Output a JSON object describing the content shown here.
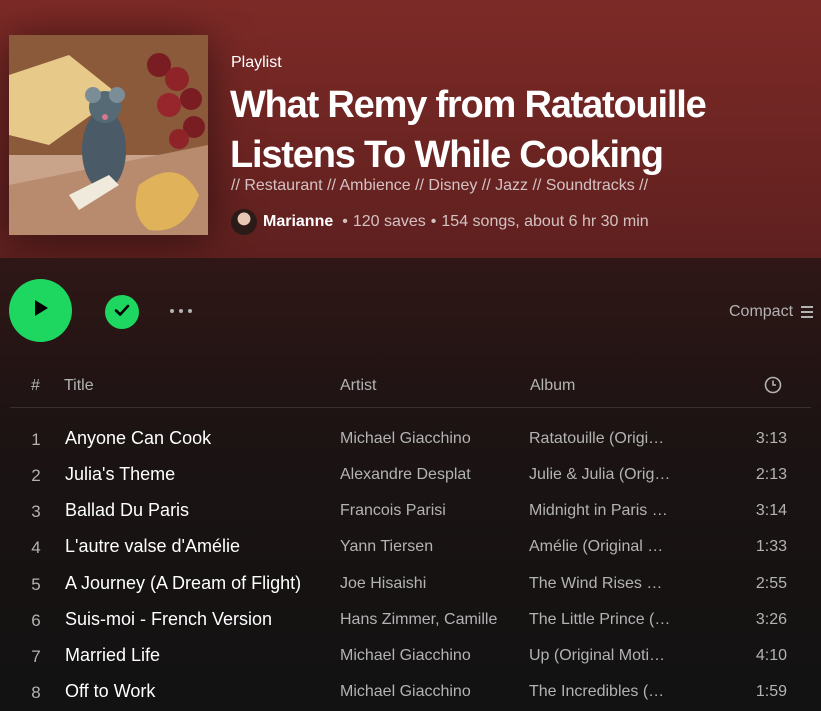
{
  "playlist": {
    "type_label": "Playlist",
    "title": "What Remy from Ratatouille Listens To While Cooking",
    "description": "// Restaurant // Ambience // Disney // Jazz // Soundtracks //",
    "owner": "Marianne",
    "saves": "120 saves",
    "stats": "154 songs, about 6 hr 30 min",
    "separator": "•"
  },
  "controls": {
    "compact_label": "Compact"
  },
  "columns": {
    "number": "#",
    "title": "Title",
    "artist": "Artist",
    "album": "Album"
  },
  "tracks": [
    {
      "num": "1",
      "title": "Anyone Can Cook",
      "artist": "Michael Giacchino",
      "album": "Ratatouille (Original Motion Picture Soundtrack)",
      "duration": "3:13"
    },
    {
      "num": "2",
      "title": "Julia's Theme",
      "artist": "Alexandre Desplat",
      "album": "Julie & Julia (Original Motion Picture Soundtrack)",
      "duration": "2:13"
    },
    {
      "num": "3",
      "title": "Ballad Du Paris",
      "artist": "Francois Parisi",
      "album": "Midnight in Paris (Music from the Motion Picture)",
      "duration": "3:14"
    },
    {
      "num": "4",
      "title": "L'autre valse d'Amélie",
      "artist": "Yann Tiersen",
      "album": "Amélie (Original Soundtrack)",
      "duration": "1:33"
    },
    {
      "num": "5",
      "title": "A Journey (A Dream of Flight)",
      "artist": "Joe Hisaishi",
      "album": "The Wind Rises Soundtrack",
      "duration": "2:55"
    },
    {
      "num": "6",
      "title": "Suis-moi - French Version",
      "artist": "Hans Zimmer, Camille",
      "album": "The Little Prince (Original Motion Picture Soundtrack)",
      "duration": "3:26"
    },
    {
      "num": "7",
      "title": "Married Life",
      "artist": "Michael Giacchino",
      "album": "Up (Original Motion Picture Soundtrack)",
      "duration": "4:10"
    },
    {
      "num": "8",
      "title": "Off to Work",
      "artist": "Michael Giacchino",
      "album": "The Incredibles (Original Motion Picture Soundtrack)",
      "duration": "1:59"
    }
  ],
  "icons": {
    "play": "play-icon",
    "saved": "check-icon",
    "more": "more-options-icon",
    "list_view": "list-icon",
    "duration": "clock-icon"
  },
  "colors": {
    "accent": "#1ed760",
    "header_bg": "#7d2a27",
    "page_bg": "#121212"
  }
}
